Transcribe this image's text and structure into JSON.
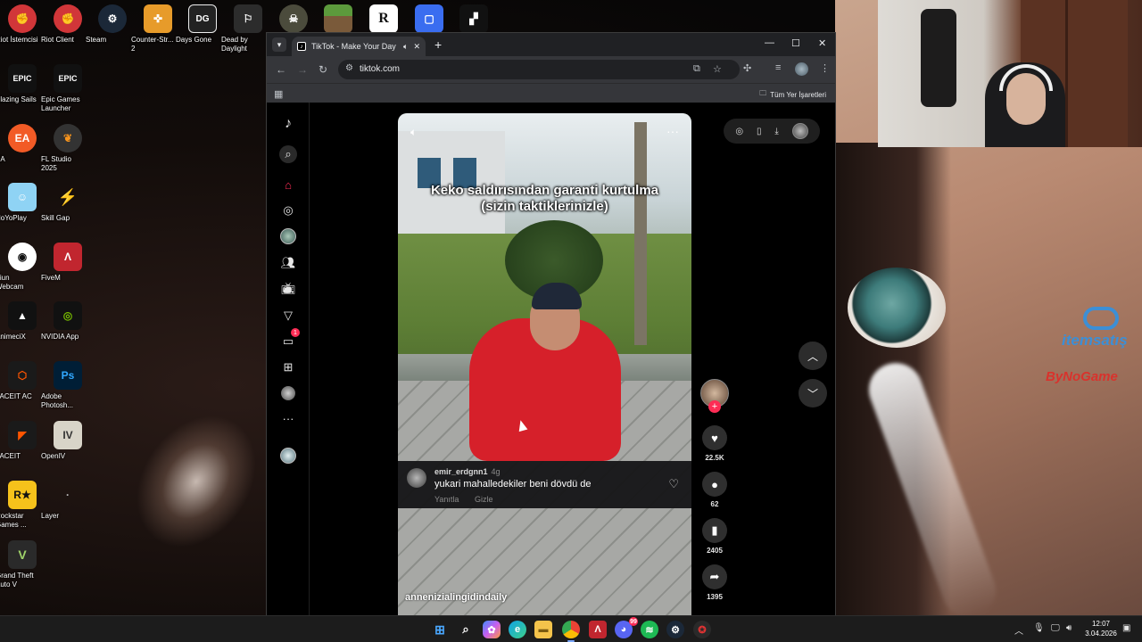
{
  "desktop": {
    "icons_col1": [
      {
        "label": "Riot İstemcisi",
        "icon": "riot-icon"
      },
      {
        "label": "Blazing Sails",
        "icon": "epic-games-icon"
      },
      {
        "label": "EA",
        "icon": "ea-icon"
      },
      {
        "label": "HoYoPlay",
        "icon": "hoyoplay-icon"
      },
      {
        "label": "Iriun\nWebcam",
        "icon": "iriun-icon"
      },
      {
        "label": "AnimeciX",
        "icon": "animecix-icon"
      },
      {
        "label": "FACEIT AC",
        "icon": "faceit-ac-icon"
      },
      {
        "label": "FACEIT",
        "icon": "faceit-icon"
      },
      {
        "label": "Rockstar\nGames ...",
        "icon": "rockstar-icon"
      },
      {
        "label": "Grand Theft\nAuto V",
        "icon": "gta-icon"
      }
    ],
    "icons_col2": [
      {
        "label": "Riot Client",
        "icon": "riot-client-icon"
      },
      {
        "label": "Epic Games\nLauncher",
        "icon": "epic-launcher-icon"
      },
      {
        "label": "FL Studio\n2025",
        "icon": "fl-studio-icon"
      },
      {
        "label": "Skill Gap",
        "icon": "skill-gap-icon"
      },
      {
        "label": "FiveM",
        "icon": "fivem-icon"
      },
      {
        "label": "NVIDIA App",
        "icon": "nvidia-icon"
      },
      {
        "label": "Adobe\nPhotosh...",
        "icon": "photoshop-icon"
      },
      {
        "label": "OpenIV",
        "icon": "openiv-icon"
      },
      {
        "label": "Layer",
        "icon": "layer-icon"
      }
    ],
    "icons_top": [
      {
        "label": "Steam",
        "icon": "steam-icon"
      },
      {
        "label": "Counter-Str...\n2",
        "icon": "cs2-icon"
      },
      {
        "label": "Days Gone",
        "icon": "days-gone-icon"
      },
      {
        "label": "Dead by\nDaylight",
        "icon": "dbd-icon"
      },
      {
        "label": "",
        "icon": "game-icon"
      },
      {
        "label": "",
        "icon": "minecraft-icon"
      },
      {
        "label": "",
        "icon": "rockstar-launcher-icon"
      },
      {
        "label": "",
        "icon": "roblox-icon"
      },
      {
        "label": "",
        "icon": "roblox-studio-icon"
      }
    ],
    "wallpaper_brands": {
      "itemsatis": "itemsatış",
      "bynogame": "ByNoGame"
    }
  },
  "browser": {
    "tab_title": "TikTok - Make Your Day",
    "url": "tiktok.com",
    "bookmarks_all": "Tüm Yer İşaretleri"
  },
  "tiktok": {
    "video": {
      "caption": "Keko saldırısından garanti kurtulma\n(sizin taktiklerinizle)",
      "handle": "annenizialingidindaily"
    },
    "comment": {
      "username": "emir_erdgnn1",
      "time": "4g",
      "text": "yukari mahalledekiler beni dövdü de",
      "reply": "Yanıtla",
      "hide": "Gizle"
    },
    "actions": {
      "likes": "22.5K",
      "comments": "62",
      "saves": "2405",
      "shares": "1395"
    },
    "inbox_badge": "1"
  },
  "taskbar": {
    "time": "12:07",
    "date": "3.04.2026",
    "discord_badge": "99"
  },
  "colors": {
    "accent": "#fe2c55",
    "taskbar": "#1c1c1c",
    "browser_frame": "#35363a"
  }
}
